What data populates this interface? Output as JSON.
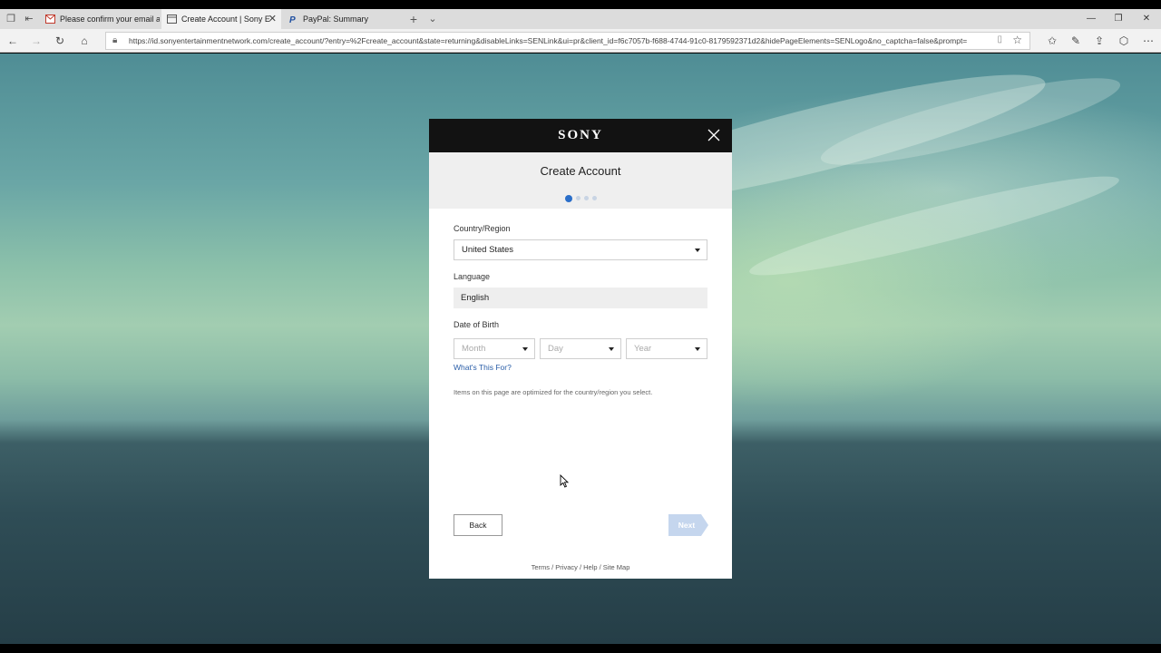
{
  "browser": {
    "tabs": [
      {
        "title": "Please confirm your email a",
        "active": false
      },
      {
        "title": "Create Account | Sony E",
        "active": true
      },
      {
        "title": "PayPal: Summary",
        "active": false
      }
    ],
    "url": "https://id.sonyentertainmentnetwork.com/create_account/?entry=%2Fcreate_account&state=returning&disableLinks=SENLink&ui=pr&client_id=f6c7057b-f688-4744-91c0-8179592371d2&hidePageElements=SENLogo&no_captcha=false&prompt="
  },
  "dialog": {
    "brand": "SONY",
    "title": "Create Account",
    "steps": {
      "total": 4,
      "current": 1
    },
    "country": {
      "label": "Country/Region",
      "value": "United States"
    },
    "language": {
      "label": "Language",
      "value": "English"
    },
    "dob": {
      "label": "Date of Birth",
      "month_placeholder": "Month",
      "day_placeholder": "Day",
      "year_placeholder": "Year"
    },
    "whats_this_for": "What's This For?",
    "info": "Items on this page are optimized for the country/region you select.",
    "back_label": "Back",
    "next_label": "Next",
    "footer": "Terms / Privacy / Help / Site Map"
  },
  "colors": {
    "accent": "#2a6ec9",
    "next_disabled": "#c5d6ee",
    "header": "#121212"
  }
}
